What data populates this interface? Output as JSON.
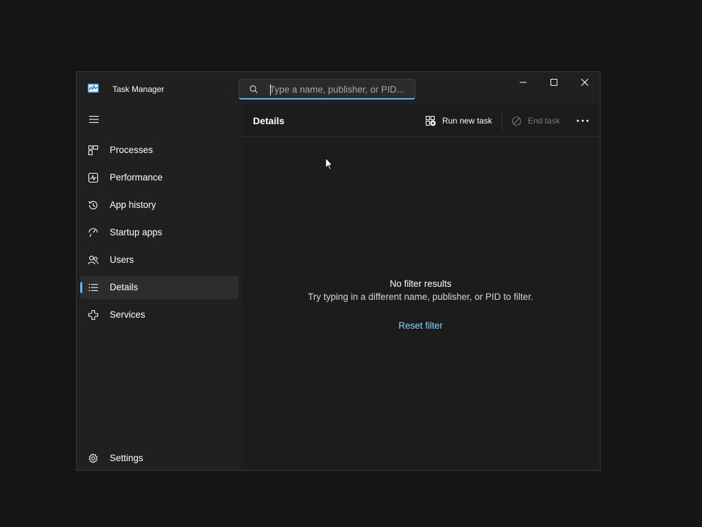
{
  "window": {
    "title": "Task Manager",
    "controls": {
      "minimize": "minimize-icon",
      "maximize": "maximize-icon",
      "close": "close-icon"
    }
  },
  "search": {
    "placeholder": "Type a name, publisher, or PID...",
    "value": ""
  },
  "sidebar": {
    "items": [
      {
        "label": "Processes",
        "icon": "processes-icon",
        "selected": false
      },
      {
        "label": "Performance",
        "icon": "performance-icon",
        "selected": false
      },
      {
        "label": "App history",
        "icon": "app-history-icon",
        "selected": false
      },
      {
        "label": "Startup apps",
        "icon": "startup-apps-icon",
        "selected": false
      },
      {
        "label": "Users",
        "icon": "users-icon",
        "selected": false
      },
      {
        "label": "Details",
        "icon": "details-icon",
        "selected": true
      },
      {
        "label": "Services",
        "icon": "services-icon",
        "selected": false
      }
    ],
    "settings_label": "Settings"
  },
  "main": {
    "page_title": "Details",
    "toolbar": {
      "run_new_task": "Run new task",
      "end_task": "End task"
    },
    "empty_state": {
      "title": "No filter results",
      "subtitle": "Try typing in a different name, publisher, or PID to filter.",
      "reset_label": "Reset filter"
    }
  },
  "colors": {
    "accent": "#4cc2ff",
    "link": "#7fd8ff",
    "window_bg": "#202020",
    "content_bg": "#1c1c1c",
    "disabled_text": "#7a7a7a"
  }
}
